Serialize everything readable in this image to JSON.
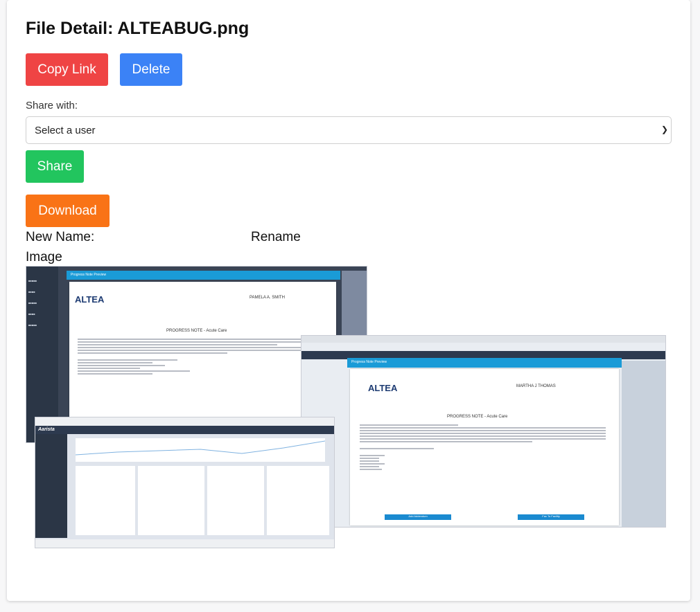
{
  "page": {
    "title": "File Detail: ALTEABUG.png"
  },
  "actions": {
    "copy_link": "Copy Link",
    "delete": "Delete",
    "share": "Share",
    "download": "Download"
  },
  "share_form": {
    "label": "Share with:",
    "select_value": "Select a user"
  },
  "rename": {
    "new_name_label": "New Name:",
    "rename_label": "Rename"
  },
  "image_section": {
    "label": "Image",
    "embedded": {
      "back": {
        "modal_title": "Progress Note Preview",
        "brand": "ALTEA",
        "patient": "PAMELA A. SMITH",
        "heading": "PROGRESS NOTE - Acute Care"
      },
      "right": {
        "modal_title": "Progress Note Preview",
        "brand": "ALTEA",
        "patient": "MARTHA J THOMAS",
        "heading": "PROGRESS NOTE - Acute Care",
        "btn_left": "Add Addendum",
        "btn_right": "Fax To Facility"
      },
      "front": {
        "brand": "Aarista"
      }
    }
  },
  "colors": {
    "copy": "#ef4444",
    "delete": "#3b82f6",
    "share": "#22c55e",
    "download": "#f97316"
  }
}
